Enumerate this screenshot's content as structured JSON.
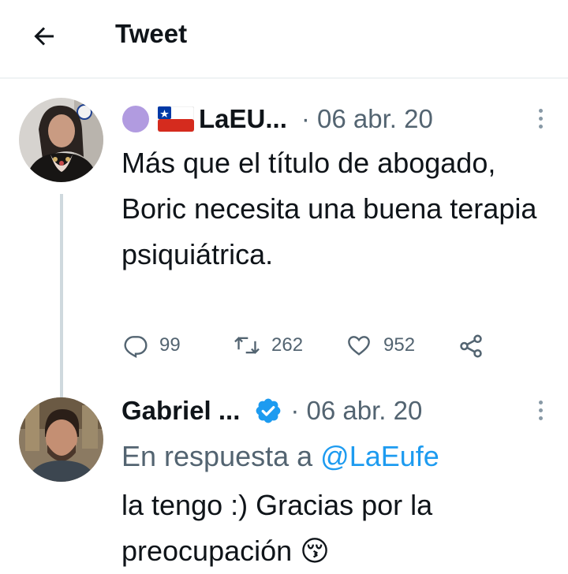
{
  "header": {
    "title": "Tweet"
  },
  "tweet1": {
    "display_name": "LaEU...",
    "date": "· 06 abr. 20",
    "text": "Más que el título de abogado, Boric necesita una buena terapia psiquiátrica.",
    "stats": {
      "replies": "99",
      "retweets": "262",
      "likes": "952"
    }
  },
  "tweet2": {
    "display_name": "Gabriel ...",
    "date": "· 06 abr. 20",
    "reply_prefix": "En respuesta a",
    "reply_handle": "@LaEufe",
    "text": "la tengo :) Gracias por la preocupación",
    "emoji": "😚"
  },
  "colors": {
    "accent": "#1d9bf0",
    "secondary_text": "#536471",
    "divider": "#eff3f4",
    "verified": "#1d9bf0"
  },
  "icons": [
    "back-arrow-icon",
    "reply-icon",
    "retweet-icon",
    "like-icon",
    "share-icon",
    "more-icon",
    "verified-badge-icon",
    "chile-flag-icon",
    "purple-circle-emoji-icon",
    "kissing-face-emoji-icon"
  ]
}
